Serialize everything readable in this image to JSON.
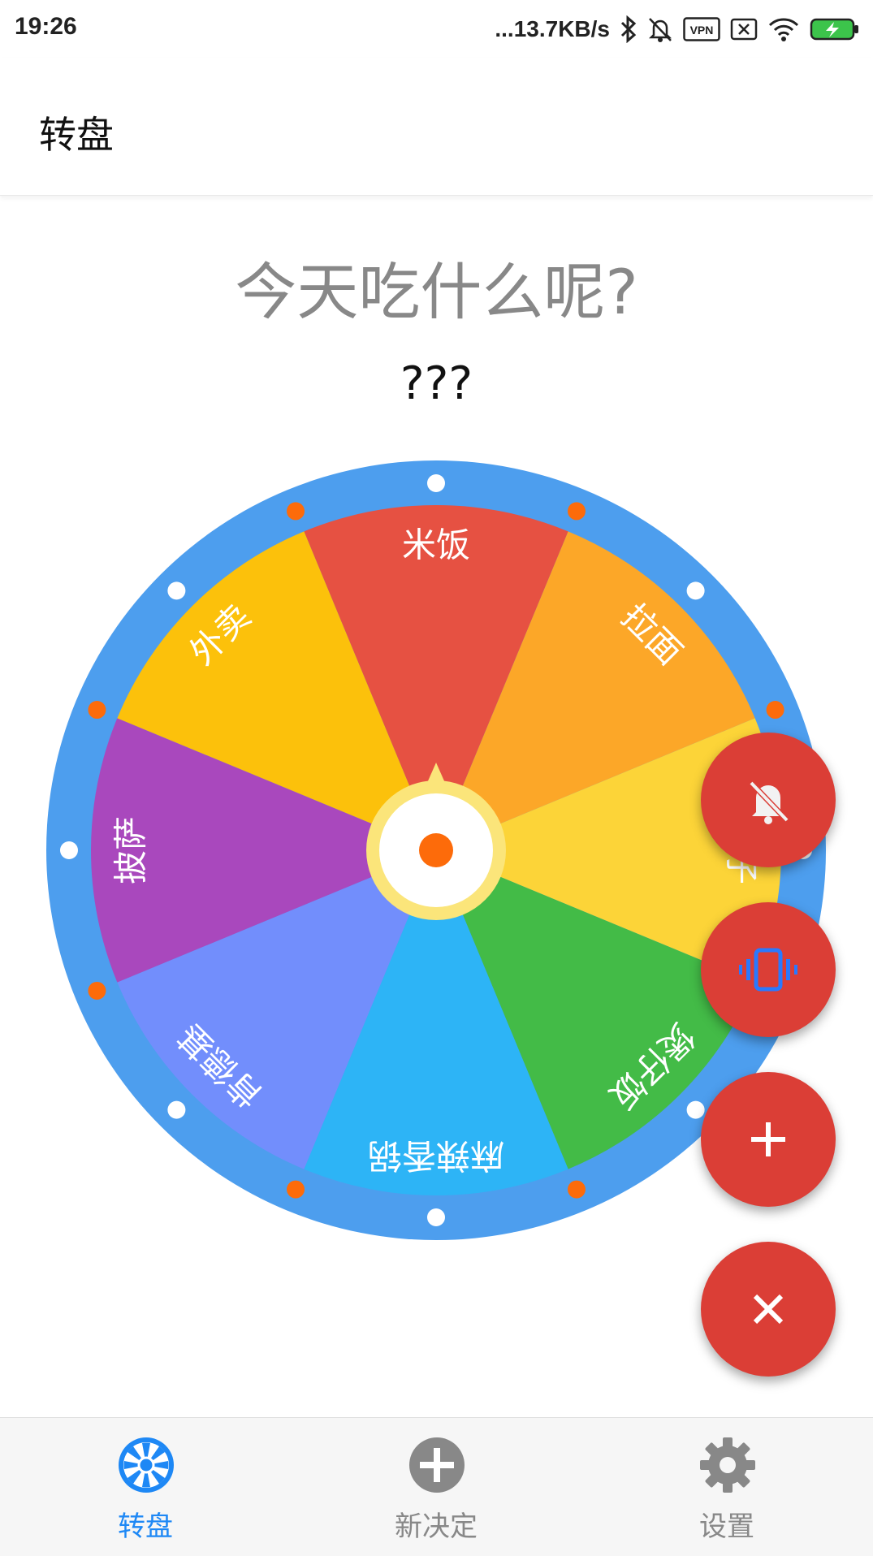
{
  "status_bar": {
    "time": "19:26",
    "network_speed": "...13.7KB/s",
    "icons": [
      "bluetooth-icon",
      "mute-icon",
      "vpn-icon",
      "no-sim-icon",
      "wifi-icon",
      "battery-charging-icon"
    ],
    "vpn_label": "VPN"
  },
  "app_bar": {
    "title": "转盘"
  },
  "main": {
    "question": "今天吃什么呢?",
    "result": "???"
  },
  "wheel": {
    "segments": [
      {
        "label": "米饭",
        "color": "#e65142"
      },
      {
        "label": "拉面",
        "color": "#fca728"
      },
      {
        "label": "饺子",
        "color": "#fcd438"
      },
      {
        "label": "煲仔饭",
        "color": "#43bb47"
      },
      {
        "label": "麻辣香锅",
        "color": "#2db4f6"
      },
      {
        "label": "肯德基",
        "color": "#728efc"
      },
      {
        "label": "披萨",
        "color": "#a948bd"
      },
      {
        "label": "外卖",
        "color": "#fcc10b"
      }
    ],
    "rim_color": "#4d9eee",
    "center_ring_color": "#fbe57a",
    "center_dot_color": "#fd6b0a",
    "dot_colors": [
      "#ffffff",
      "#fd6b0a"
    ]
  },
  "fabs": [
    {
      "name": "mute-fab",
      "icon": "bell-off-icon",
      "icon_color": "#f2f2f2"
    },
    {
      "name": "vibrate-fab",
      "icon": "vibrate-icon",
      "icon_color": "#2979ff"
    },
    {
      "name": "add-fab",
      "icon": "plus-icon",
      "icon_color": "#ffffff"
    },
    {
      "name": "close-fab",
      "icon": "close-icon",
      "icon_color": "#ffffff"
    }
  ],
  "bottom_nav": {
    "items": [
      {
        "label": "转盘",
        "icon": "wheel-icon",
        "active": true
      },
      {
        "label": "新决定",
        "icon": "add-circle-icon",
        "active": false
      },
      {
        "label": "设置",
        "icon": "gear-icon",
        "active": false
      }
    ],
    "active_color": "#1e88f5",
    "inactive_color": "#888888"
  }
}
